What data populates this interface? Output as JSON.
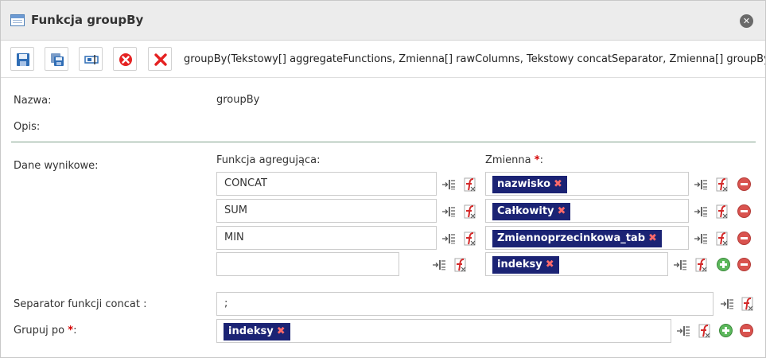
{
  "dialog": {
    "title": "Funkcja groupBy",
    "close_glyph": "✕"
  },
  "toolbar": {
    "buttons": [
      {
        "icon": "save-icon"
      },
      {
        "icon": "save-as-icon"
      },
      {
        "icon": "rename-icon"
      },
      {
        "icon": "delete-icon"
      },
      {
        "icon": "cancel-icon"
      }
    ],
    "signature": "groupBy(Tekstowy[] aggregateFunctions, Zmienna[] rawColumns, Tekstowy concatSeparator, Zmienna[] groupByColumns)"
  },
  "form": {
    "name_label": "Nazwa:",
    "name_value": "groupBy",
    "description_label": "Opis:",
    "output_label": "Dane wynikowe:",
    "agg_function_header": "Funkcja agregująca:",
    "variable_header": "Zmienna",
    "required_mark": "*",
    "header_colon": ":",
    "rows": [
      {
        "function": "CONCAT",
        "variable": "nazwisko"
      },
      {
        "function": "SUM",
        "variable": "Całkowity"
      },
      {
        "function": "MIN",
        "variable": "Zmiennoprzecinkowa_tab"
      },
      {
        "function": "",
        "variable": "indeksy"
      }
    ],
    "separator_label": "Separator funkcji concat :",
    "separator_value": ";",
    "groupby_label": "Grupuj po",
    "groupby_colon": ":",
    "groupby_value": "indeksy",
    "tag_remove_glyph": "✖"
  },
  "colors": {
    "tag_bg": "#1b2374",
    "remove_red": "#d9534f",
    "add_green": "#5cb85c",
    "required": "#d40000"
  }
}
